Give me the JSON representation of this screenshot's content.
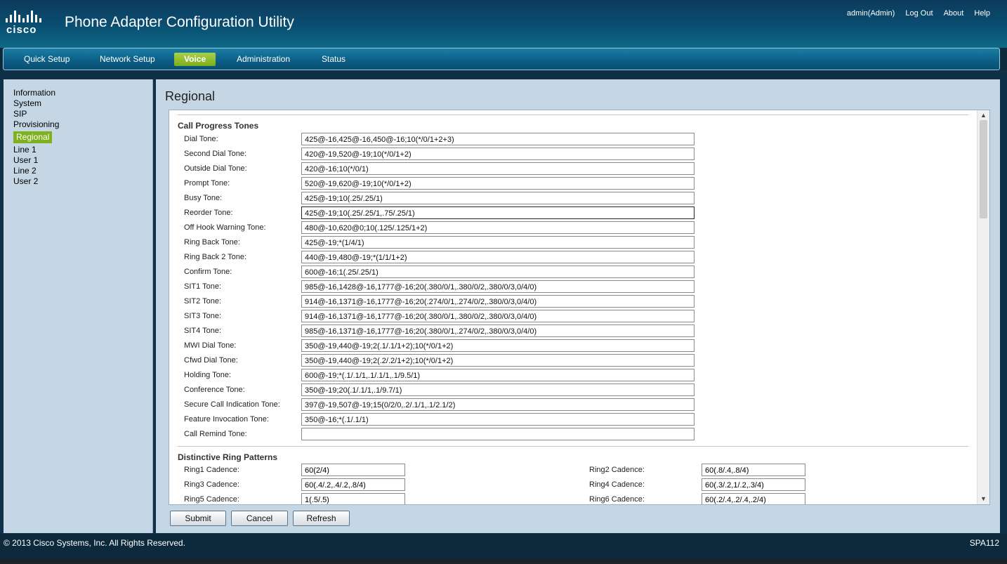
{
  "header": {
    "brand": "cisco",
    "title": "Phone Adapter Configuration Utility",
    "user": "admin(Admin)",
    "logout": "Log Out",
    "about": "About",
    "help": "Help"
  },
  "tabs": [
    {
      "label": "Quick Setup"
    },
    {
      "label": "Network Setup"
    },
    {
      "label": "Voice",
      "active": true
    },
    {
      "label": "Administration"
    },
    {
      "label": "Status"
    }
  ],
  "sidebar": [
    {
      "label": "Information"
    },
    {
      "label": "System"
    },
    {
      "label": "SIP"
    },
    {
      "label": "Provisioning"
    },
    {
      "label": "Regional",
      "active": true
    },
    {
      "label": "Line 1"
    },
    {
      "label": "User 1"
    },
    {
      "label": "Line 2"
    },
    {
      "label": "User 2"
    }
  ],
  "page": {
    "title": "Regional"
  },
  "call_progress": {
    "title": "Call Progress Tones",
    "rows": [
      {
        "label": "Dial Tone:",
        "value": "425@-16,425@-16,450@-16;10(*/0/1+2+3)"
      },
      {
        "label": "Second Dial Tone:",
        "value": "420@-19,520@-19;10(*/0/1+2)"
      },
      {
        "label": "Outside Dial Tone:",
        "value": "420@-16;10(*/0/1)"
      },
      {
        "label": "Prompt Tone:",
        "value": "520@-19,620@-19;10(*/0/1+2)"
      },
      {
        "label": "Busy Tone:",
        "value": "425@-19;10(.25/.25/1)"
      },
      {
        "label": "Reorder Tone:",
        "value": "425@-19;10(.25/.25/1,.75/.25/1)"
      },
      {
        "label": "Off Hook Warning Tone:",
        "value": "480@-10,620@0;10(.125/.125/1+2)"
      },
      {
        "label": "Ring Back Tone:",
        "value": "425@-19;*(1/4/1)"
      },
      {
        "label": "Ring Back 2 Tone:",
        "value": "440@-19,480@-19;*(1/1/1+2)"
      },
      {
        "label": "Confirm Tone:",
        "value": "600@-16;1(.25/.25/1)"
      },
      {
        "label": "SIT1 Tone:",
        "value": "985@-16,1428@-16,1777@-16;20(.380/0/1,.380/0/2,.380/0/3,0/4/0)"
      },
      {
        "label": "SIT2 Tone:",
        "value": "914@-16,1371@-16,1777@-16;20(.274/0/1,.274/0/2,.380/0/3,0/4/0)"
      },
      {
        "label": "SIT3 Tone:",
        "value": "914@-16,1371@-16,1777@-16;20(.380/0/1,.380/0/2,.380/0/3,0/4/0)"
      },
      {
        "label": "SIT4 Tone:",
        "value": "985@-16,1371@-16,1777@-16;20(.380/0/1,.274/0/2,.380/0/3,0/4/0)"
      },
      {
        "label": "MWI Dial Tone:",
        "value": "350@-19,440@-19;2(.1/.1/1+2);10(*/0/1+2)"
      },
      {
        "label": "Cfwd Dial Tone:",
        "value": "350@-19,440@-19;2(.2/.2/1+2);10(*/0/1+2)"
      },
      {
        "label": "Holding Tone:",
        "value": "600@-19;*(.1/.1/1,.1/.1/1,.1/9.5/1)"
      },
      {
        "label": "Conference Tone:",
        "value": "350@-19;20(.1/.1/1,.1/9.7/1)"
      },
      {
        "label": "Secure Call Indication Tone:",
        "value": "397@-19,507@-19;15(0/2/0,.2/.1/1,.1/2.1/2)"
      },
      {
        "label": "Feature Invocation Tone:",
        "value": "350@-16;*(.1/.1/1)"
      },
      {
        "label": "Call Remind Tone:",
        "value": ""
      }
    ]
  },
  "ring_patterns": {
    "title": "Distinctive Ring Patterns",
    "rows": [
      {
        "label": "Ring1 Cadence:",
        "value": "60(2/4)"
      },
      {
        "label": "Ring2 Cadence:",
        "value": "60(.8/.4,.8/4)"
      },
      {
        "label": "Ring3 Cadence:",
        "value": "60(.4/.2,.4/.2,.8/4)"
      },
      {
        "label": "Ring4 Cadence:",
        "value": "60(.3/.2,1/.2,.3/4)"
      },
      {
        "label": "Ring5 Cadence:",
        "value": "1(.5/.5)"
      },
      {
        "label": "Ring6 Cadence:",
        "value": "60(.2/.4,.2/.4,.2/4)"
      }
    ]
  },
  "buttons": {
    "submit": "Submit",
    "cancel": "Cancel",
    "refresh": "Refresh"
  },
  "footer": {
    "copyright": "© 2013 Cisco Systems, Inc. All Rights Reserved.",
    "model": "SPA112"
  }
}
